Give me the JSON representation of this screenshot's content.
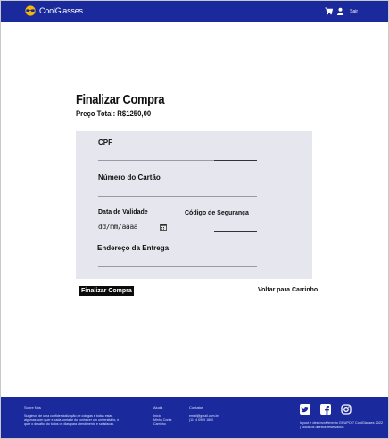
{
  "header": {
    "brand": "CoolGlasses",
    "exit_label": "Sair"
  },
  "page": {
    "title": "Finalizar Compra",
    "total_label": "Preço Total: R$1250,00"
  },
  "form": {
    "cpf_label": "CPF",
    "card_label": "Número do Cartão",
    "expiry_label": "Data de Validade",
    "expiry_placeholder": "dd/mm/aaaa",
    "security_label": "Código de Segurança",
    "address_label": "Endereço da Entrega"
  },
  "actions": {
    "finish_label": "Finalizar Compra",
    "back_label": "Voltar para Carrinho"
  },
  "footer": {
    "about_title": "Sobre Nós",
    "about_text": "Surgimos de uma confidencialização de colegas e todas estas algumas com quer e cada vontade do conhecer um universitário, e quer o desafio ato todos os dias para atendimento e satisfacao.",
    "links_title": "Ajuda",
    "links": [
      "Início",
      "Minha Conta",
      "Carrinho"
    ],
    "contact_title": "Contatos",
    "contact": [
      "email@gmail.com.br",
      "(11) 4 0909 1800"
    ],
    "note": "layout e desenvolvimento GRUPO 7 CoolGlasses 2022 | todos os direitos reservados"
  },
  "colors": {
    "brand_blue": "#1a2a9c",
    "card_bg": "#e6e6ee",
    "button_bg": "#0b0b0b"
  }
}
